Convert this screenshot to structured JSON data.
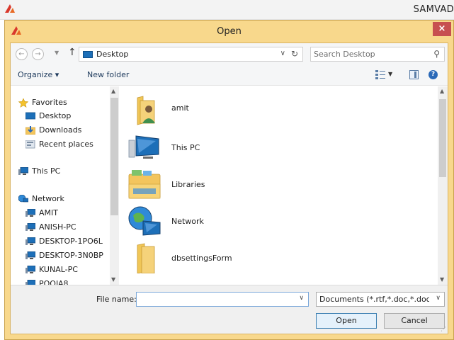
{
  "app": {
    "title": "SAMVAD"
  },
  "dialog": {
    "title": "Open",
    "close_glyph": "×"
  },
  "address": {
    "location": "Desktop",
    "search_placeholder": "Search Desktop"
  },
  "toolbar": {
    "organize": "Organize ▾",
    "new_folder": "New folder"
  },
  "nav": {
    "items": [
      {
        "label": "Favorites",
        "icon": "star-icon"
      },
      {
        "label": "Desktop",
        "icon": "desktop-icon"
      },
      {
        "label": "Downloads",
        "icon": "downloads-icon"
      },
      {
        "label": "Recent places",
        "icon": "recent-places-icon"
      },
      {
        "label": "This PC",
        "icon": "computer-icon"
      },
      {
        "label": "Network",
        "icon": "network-icon"
      },
      {
        "label": "AMIT",
        "icon": "computer-icon"
      },
      {
        "label": "ANISH-PC",
        "icon": "computer-icon"
      },
      {
        "label": "DESKTOP-1PO6L",
        "icon": "computer-icon"
      },
      {
        "label": "DESKTOP-3N0BP",
        "icon": "computer-icon"
      },
      {
        "label": "KUNAL-PC",
        "icon": "computer-icon"
      },
      {
        "label": "POOJA8",
        "icon": "computer-icon"
      }
    ]
  },
  "files": [
    {
      "label": "amit",
      "icon": "user-folder-icon"
    },
    {
      "label": "This PC",
      "icon": "computer-icon"
    },
    {
      "label": "Libraries",
      "icon": "libraries-icon"
    },
    {
      "label": "Network",
      "icon": "network-globe-icon"
    },
    {
      "label": "dbsettingsForm",
      "icon": "folder-icon"
    }
  ],
  "bottom": {
    "file_name_label": "File name:",
    "file_name_value": "",
    "filter": "Documents (*.rtf,*.doc,*.docx,*.txt)",
    "open_label": "Open",
    "cancel_label": "Cancel"
  },
  "colors": {
    "dialog_frame": "#f8d88c",
    "close_button": "#c75050",
    "accent": "#1d6fb8"
  }
}
